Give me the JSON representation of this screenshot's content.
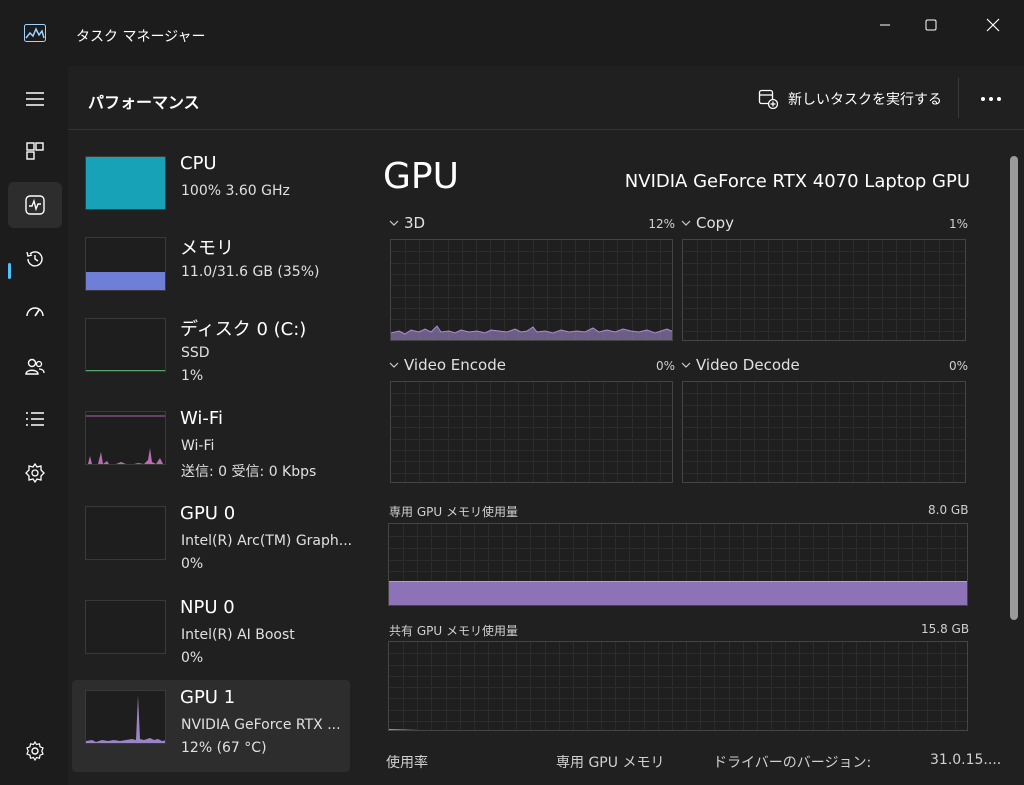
{
  "window": {
    "title": "タスク マネージャー"
  },
  "header": {
    "title": "パフォーマンス",
    "new_task_label": "新しいタスクを実行する"
  },
  "rail": {
    "items": [
      "menu-icon",
      "processes-icon",
      "performance-icon",
      "app-history-icon",
      "startup-apps-icon",
      "users-icon",
      "details-icon",
      "services-icon"
    ],
    "active": "performance-icon",
    "settings": "settings-icon"
  },
  "devices": [
    {
      "name": "CPU",
      "line1": "100%  3.60 GHz",
      "line2": "",
      "color": "#17a2b8",
      "fill": 1.0
    },
    {
      "name": "メモリ",
      "line1": "11.0/31.6 GB (35%)",
      "line2": "",
      "color": "#6f7fd8",
      "fill": 0.35
    },
    {
      "name": "ディスク 0 (C:)",
      "line1": "SSD",
      "line2": "1%",
      "color": "#5aa36a",
      "fill": 0.01
    },
    {
      "name": "Wi-Fi",
      "line1": "Wi-Fi",
      "line2": "送信: 0  受信: 0 Kbps",
      "color": "#d87ad1"
    },
    {
      "name": "GPU 0",
      "line1": "Intel(R) Arc(TM) Graph...",
      "line2": "0%",
      "color": "#a98fd6"
    },
    {
      "name": "NPU 0",
      "line1": "Intel(R) AI Boost",
      "line2": "0%",
      "color": "#a98fd6"
    },
    {
      "name": "GPU 1",
      "line1": "NVIDIA GeForce RTX ...",
      "line2": "12% (67 °C)",
      "color": "#a98fd6",
      "selected": true
    }
  ],
  "gpu": {
    "title": "GPU",
    "model": "NVIDIA GeForce RTX 4070 Laptop GPU",
    "engines": [
      {
        "name": "3D",
        "percent": "12%"
      },
      {
        "name": "Copy",
        "percent": "1%"
      },
      {
        "name": "Video Encode",
        "percent": "0%"
      },
      {
        "name": "Video Decode",
        "percent": "0%"
      }
    ],
    "dedicated_label": "専用 GPU メモリ使用量",
    "dedicated_max": "8.0 GB",
    "shared_label": "共有 GPU メモリ使用量",
    "shared_max": "15.8 GB",
    "stats": {
      "usage_label": "使用率",
      "dedicated_mem_label": "専用 GPU メモリ",
      "driver_version_label": "ドライバーのバージョン:",
      "driver_version_value": "31.0.15...."
    },
    "graph_color": "#a98fd6"
  }
}
